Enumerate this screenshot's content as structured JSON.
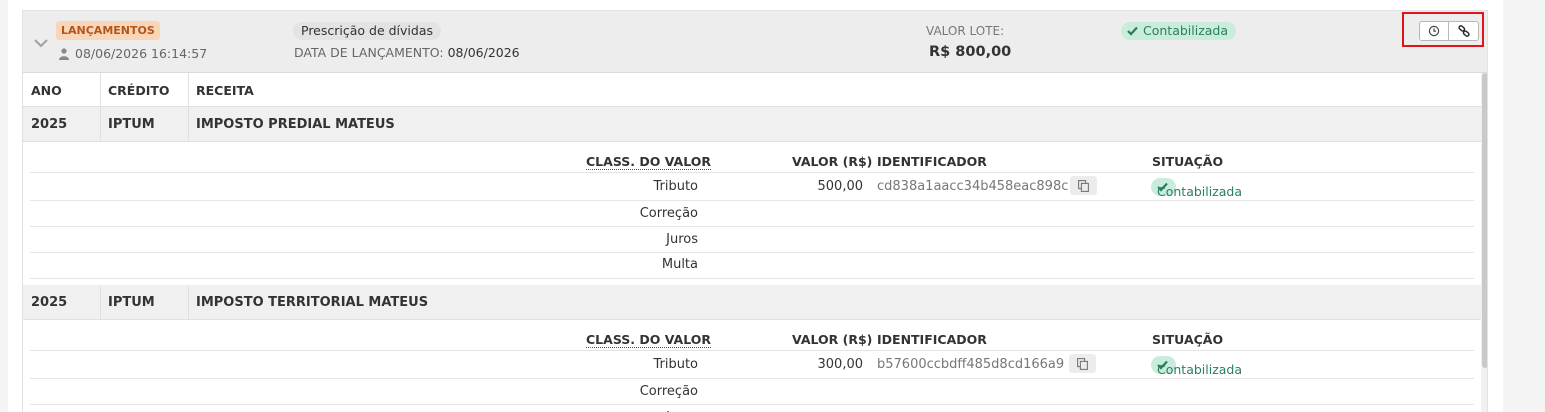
{
  "header": {
    "badge": "LANÇAMENTOS",
    "datetime": "08/06/2026 16:14:57",
    "description": "Prescrição de dívidas",
    "data_lancamento_label": "DATA DE LANÇAMENTO:",
    "data_lancamento_value": "08/06/2026",
    "valor_lote_label": "VALOR LOTE:",
    "valor_lote_value": "R$ 800,00",
    "status": "Contabilizada"
  },
  "columns": {
    "ano": "ANO",
    "credito": "CRÉDITO",
    "receita": "RECEITA"
  },
  "sub_columns": {
    "class_valor": "CLASS. DO VALOR",
    "valor": "VALOR (R$)",
    "identificador": "IDENTIFICADOR",
    "situacao": "SITUAÇÃO"
  },
  "groups": [
    {
      "ano": "2025",
      "credito": "IPTUM",
      "receita": "IMPOSTO PREDIAL MATEUS",
      "rows": [
        {
          "class": "Tributo",
          "valor": "500,00",
          "identificador": "cd838a1aacc34b458eac898c",
          "situacao": "Contabilizada"
        },
        {
          "class": "Correção",
          "valor": "",
          "identificador": "",
          "situacao": ""
        },
        {
          "class": "Juros",
          "valor": "",
          "identificador": "",
          "situacao": ""
        },
        {
          "class": "Multa",
          "valor": "",
          "identificador": "",
          "situacao": ""
        }
      ]
    },
    {
      "ano": "2025",
      "credito": "IPTUM",
      "receita": "IMPOSTO TERRITORIAL MATEUS",
      "rows": [
        {
          "class": "Tributo",
          "valor": "300,00",
          "identificador": "b57600ccbdff485d8cd166a9",
          "situacao": "Contabilizada"
        },
        {
          "class": "Correção",
          "valor": "",
          "identificador": "",
          "situacao": ""
        },
        {
          "class": "Juros",
          "valor": "",
          "identificador": "",
          "situacao": ""
        }
      ]
    }
  ],
  "colors": {
    "badge_bg": "#f9d6b8",
    "badge_text": "#b5551c",
    "status_bg": "#c9ecdc",
    "status_text": "#2a7f5b",
    "highlight": "#e0151b"
  },
  "icons": {
    "expand": "chevron-down-icon",
    "user": "user-icon",
    "status": "check-icon",
    "history": "clock-icon",
    "link": "link-icon",
    "copy": "copy-icon"
  }
}
